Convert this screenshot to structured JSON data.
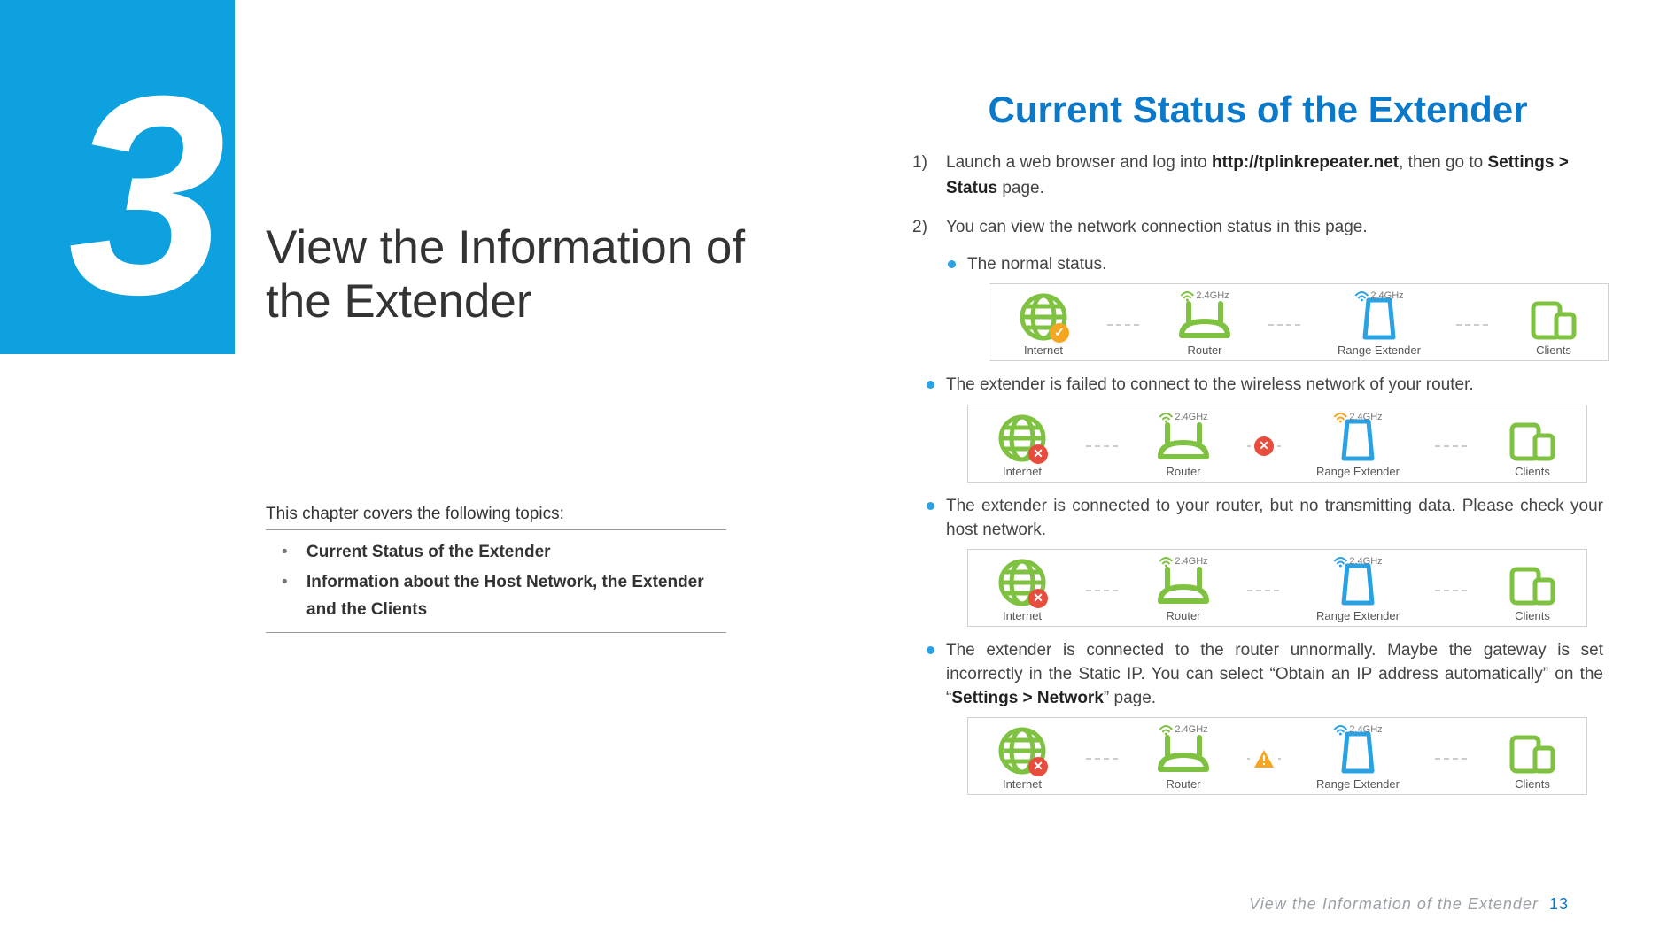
{
  "chapter": {
    "number": "3",
    "title": "View the Information of the Extender"
  },
  "topics": {
    "intro": "This chapter covers the following topics:",
    "items": [
      "Current Status of the Extender",
      "Information about the Host Network, the Extender and the Clients"
    ]
  },
  "section_heading": "Current Status of the Extender",
  "step1": {
    "prefix": "Launch a web browser and log into ",
    "url": "http://tplinkrepeater.net",
    "middle": ", then go to ",
    "path1": "Settings > Status",
    "suffix": " page."
  },
  "step2": {
    "text": "You can view the network connection status in this page."
  },
  "sub": {
    "a": "The normal status.",
    "b": "The extender is failed to connect to the wireless network of your router.",
    "c": "The extender is connected to your router, but no transmitting data. Please check your host network.",
    "d_prefix": "The extender is connected to the router unnormally. Maybe the gateway is set incorrectly in the Static IP. You can select “Obtain an IP address automatically” on the “",
    "d_bold": "Settings > Network",
    "d_suffix": "” page."
  },
  "diagram_labels": {
    "internet": "Internet",
    "router": "Router",
    "extender": "Range Extender",
    "clients": "Clients",
    "band": "2.4GHz"
  },
  "footer": {
    "text": "View the Information of the Extender",
    "page": "13"
  }
}
